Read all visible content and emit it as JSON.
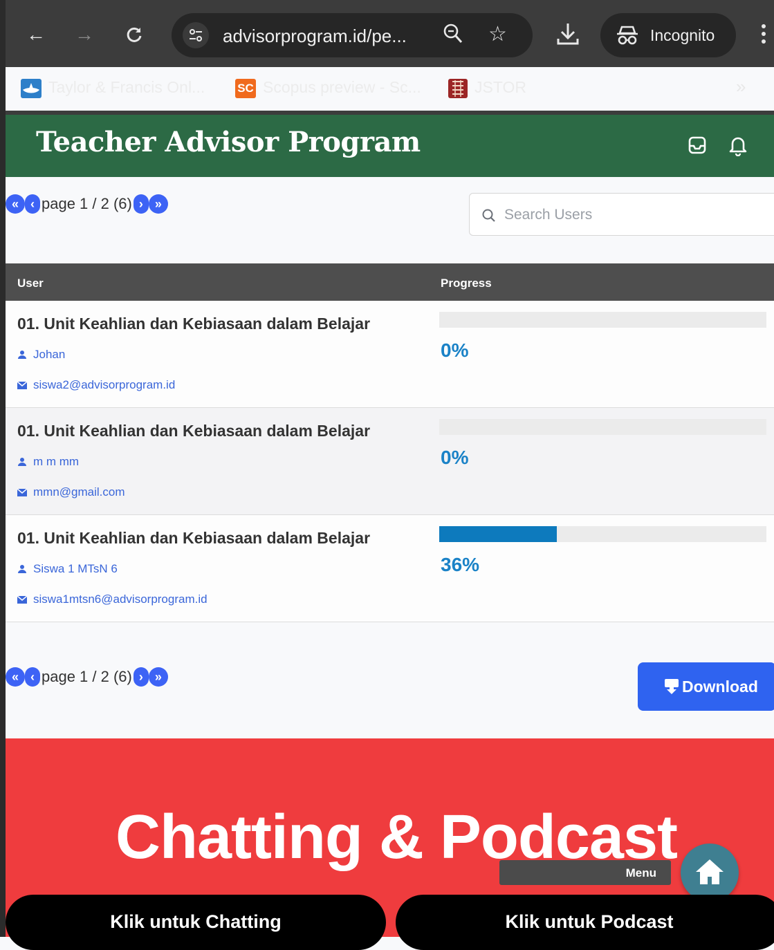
{
  "browser": {
    "url": "advisorprogram.id/pe...",
    "incognito_label": "Incognito",
    "bookmarks": [
      {
        "label": "Taylor & Francis Onl...",
        "icon": "taylor-francis-icon"
      },
      {
        "label": "Scopus preview - Sc...",
        "icon": "scopus-icon",
        "icon_text": "SC"
      },
      {
        "label": "JSTOR",
        "icon": "jstor-icon"
      }
    ],
    "more_bookmarks": "»"
  },
  "header": {
    "title": "Teacher Advisor Program",
    "icons": [
      "inbox-icon",
      "bell-icon"
    ]
  },
  "pagination": {
    "first": "«",
    "prev": "‹",
    "text": "page 1 / 2 (6)",
    "next": "›",
    "last": "»"
  },
  "search": {
    "placeholder": "Search Users"
  },
  "table": {
    "headers": {
      "user": "User",
      "progress": "Progress"
    },
    "rows": [
      {
        "title": "01. Unit Keahlian dan Kebiasaan dalam Belajar",
        "user": "Johan",
        "email": "siswa2@advisorprogram.id",
        "progress_label": "0%",
        "progress": 0
      },
      {
        "title": "01. Unit Keahlian dan Kebiasaan dalam Belajar",
        "user": "m m mm",
        "email": "mmn@gmail.com",
        "progress_label": "0%",
        "progress": 0
      },
      {
        "title": "01. Unit Keahlian dan Kebiasaan dalam Belajar",
        "user": "Siswa 1 MTsN 6",
        "email": "siswa1mtsn6@advisorprogram.id",
        "progress_label": "36%",
        "progress": 36
      }
    ]
  },
  "download_label": "Download",
  "banner": {
    "title": "Chatting & Podcast",
    "menu_label": "Menu",
    "chat_button": "Klik untuk Chatting",
    "podcast_button": "Klik untuk Podcast"
  },
  "colors": {
    "header_green": "#2c6a45",
    "accent_blue": "#3d63f5",
    "progress_blue": "#0d7abd",
    "banner_red": "#ef3c3e"
  }
}
